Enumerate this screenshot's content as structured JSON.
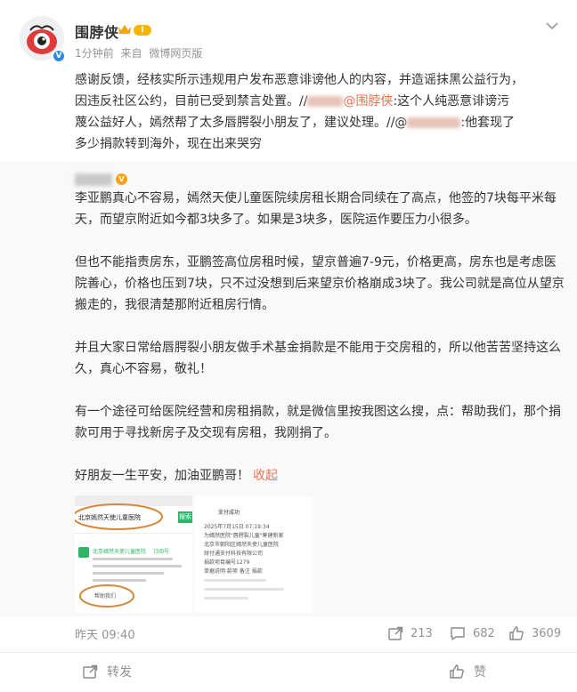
{
  "post": {
    "author": "围脖侠",
    "level": "I",
    "time_ago": "1分钟前",
    "source_prefix": "来自",
    "source": "微博网页版",
    "text_line1": "感谢反馈，经核实所示违规用户发布恶意诽谤他人的内容，并造谣抹黑公益行为，",
    "text_line2_a": "因违反社区公约，目前已受到禁言处置。//",
    "mention_self": "@围脖侠",
    "text_line2_b": ":这个人纯恶意诽谤污",
    "text_line3": "蔑公益好人，嫣然帮了太多唇腭裂小朋友了，建议处理。//@",
    "text_line3_b": ":他套现了",
    "text_line4": "多少捐款转到海外，现在出来哭穷"
  },
  "repost": {
    "paragraphs": [
      "李亚鹏真心不容易，嫣然天使儿童医院续房租长期合同续在了高点，他签的7块每平米每天，而望京附近如今都3块多了。如果是3块多，医院运作要压力小很多。",
      "但也不能指责房东，亚鹏签高位房租时候，望京普遍7-9元，价格更高，房东也是考虑医院善心，价格也压到7块，只不过没想到后来望京价格崩成3块了。我公司就是高位从望京搬走的，我很清楚那附近租房行情。",
      "并且大家日常给唇腭裂小朋友做手术基金捐款是不能用于交房租的，所以他苦苦坚持这么久，真心不容易，敬礼！",
      "有一个途径可给医院经营和房租捐款，就是微信里按我图这么搜，点：帮助我们，那个捐款可用于寻找新房子及交现有房租，我刚捐了。",
      "好朋友一生平安，加油亚鹏哥！"
    ],
    "collapse_label": "收起",
    "image1": {
      "search_text": "北京嫣然天使儿童医院",
      "search_btn": "搜索",
      "account_name": "北京嫣然天使儿童医院",
      "account_suffix": "订阅号",
      "help_text": "帮助我们"
    },
    "image2": {
      "title": "支付成功",
      "lines": [
        "2025年7月15日 07:19:34",
        "为嫣然医院\"唇腭裂儿童\"筹建新家",
        "北京市朝阳区嫣然天使儿童医院",
        "财付通支付科技有限公司",
        "捐款项目编号1279",
        "单据说明  款项  备注  捐款"
      ]
    }
  },
  "footer": {
    "time": "昨天 09:40",
    "forward_count": "213",
    "comment_count": "682",
    "like_count": "3609"
  },
  "actions": {
    "forward_label": "转发",
    "like_label": "赞"
  },
  "colors": {
    "accent": "#eb7350",
    "verified_blue": "#2d8ae6",
    "level_gold": "#f7b500",
    "gray_text": "#939393"
  }
}
